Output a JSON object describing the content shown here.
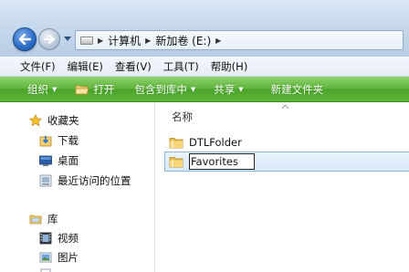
{
  "address_bar": {
    "crumbs": [
      "计算机",
      "新加卷 (E:)"
    ],
    "back_icon": "arrow-left-icon",
    "forward_icon": "arrow-right-icon"
  },
  "menu": {
    "items": [
      "文件(F)",
      "编辑(E)",
      "查看(V)",
      "工具(T)",
      "帮助(H)"
    ]
  },
  "toolbar": {
    "organize": "组织",
    "open": "打开",
    "include_in_library": "包含到库中",
    "share": "共享",
    "new_folder": "新建文件夹",
    "color": "#5cb73a"
  },
  "nav_pane": {
    "favorites": {
      "label": "收藏夹",
      "icon": "star-icon",
      "items": [
        {
          "label": "下载",
          "icon": "download-folder-icon"
        },
        {
          "label": "桌面",
          "icon": "desktop-icon"
        },
        {
          "label": "最近访问的位置",
          "icon": "recent-places-icon"
        }
      ]
    },
    "libraries": {
      "label": "库",
      "icon": "library-icon",
      "items": [
        {
          "label": "视频",
          "icon": "video-icon"
        },
        {
          "label": "图片",
          "icon": "pictures-icon"
        }
      ]
    }
  },
  "file_list": {
    "column_name": "名称",
    "items": [
      {
        "name": "DTLFolder",
        "icon": "folder-icon"
      }
    ],
    "rename": {
      "value": "Favorites",
      "icon": "folder-icon",
      "selection_color": "#d9e9f8"
    }
  }
}
